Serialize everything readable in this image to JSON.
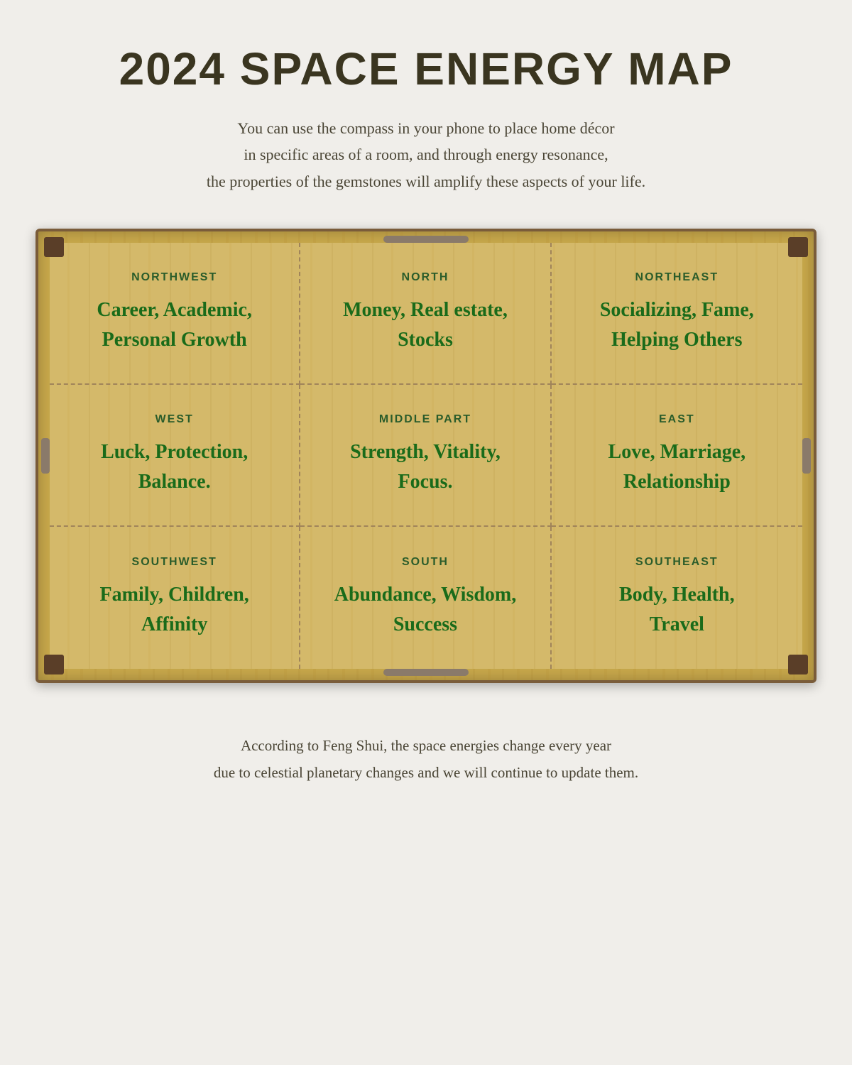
{
  "header": {
    "title": "2024 SPACE ENERGY MAP",
    "subtitle_line1": "You can use the compass in your phone to place home décor",
    "subtitle_line2": "in specific areas of a room, and through energy resonance,",
    "subtitle_line3": "the properties of the gemstones will amplify these aspects of your life."
  },
  "grid": {
    "cells": [
      {
        "id": "northwest",
        "direction": "NORTHWEST",
        "content_line1": "Career, Academic,",
        "content_line2": "Personal Growth"
      },
      {
        "id": "north",
        "direction": "NORTH",
        "content_line1": "Money, Real estate,",
        "content_line2": "Stocks"
      },
      {
        "id": "northeast",
        "direction": "NORTHEAST",
        "content_line1": "Socializing, Fame,",
        "content_line2": "Helping Others"
      },
      {
        "id": "west",
        "direction": "WEST",
        "content_line1": "Luck, Protection,",
        "content_line2": "Balance."
      },
      {
        "id": "middle",
        "direction": "MIDDLE PART",
        "content_line1": "Strength, Vitality,",
        "content_line2": "Focus."
      },
      {
        "id": "east",
        "direction": "EAST",
        "content_line1": "Love, Marriage,",
        "content_line2": "Relationship"
      },
      {
        "id": "southwest",
        "direction": "SOUTHWEST",
        "content_line1": "Family, Children,",
        "content_line2": "Affinity"
      },
      {
        "id": "south",
        "direction": "SOUTH",
        "content_line1": "Abundance, Wisdom,",
        "content_line2": "Success"
      },
      {
        "id": "southeast",
        "direction": "SOUTHEAST",
        "content_line1": "Body, Health,",
        "content_line2": "Travel"
      }
    ]
  },
  "footer": {
    "line1": "According to Feng Shui, the space energies change every year",
    "line2": "due to celestial planetary changes and we will continue to update them."
  }
}
